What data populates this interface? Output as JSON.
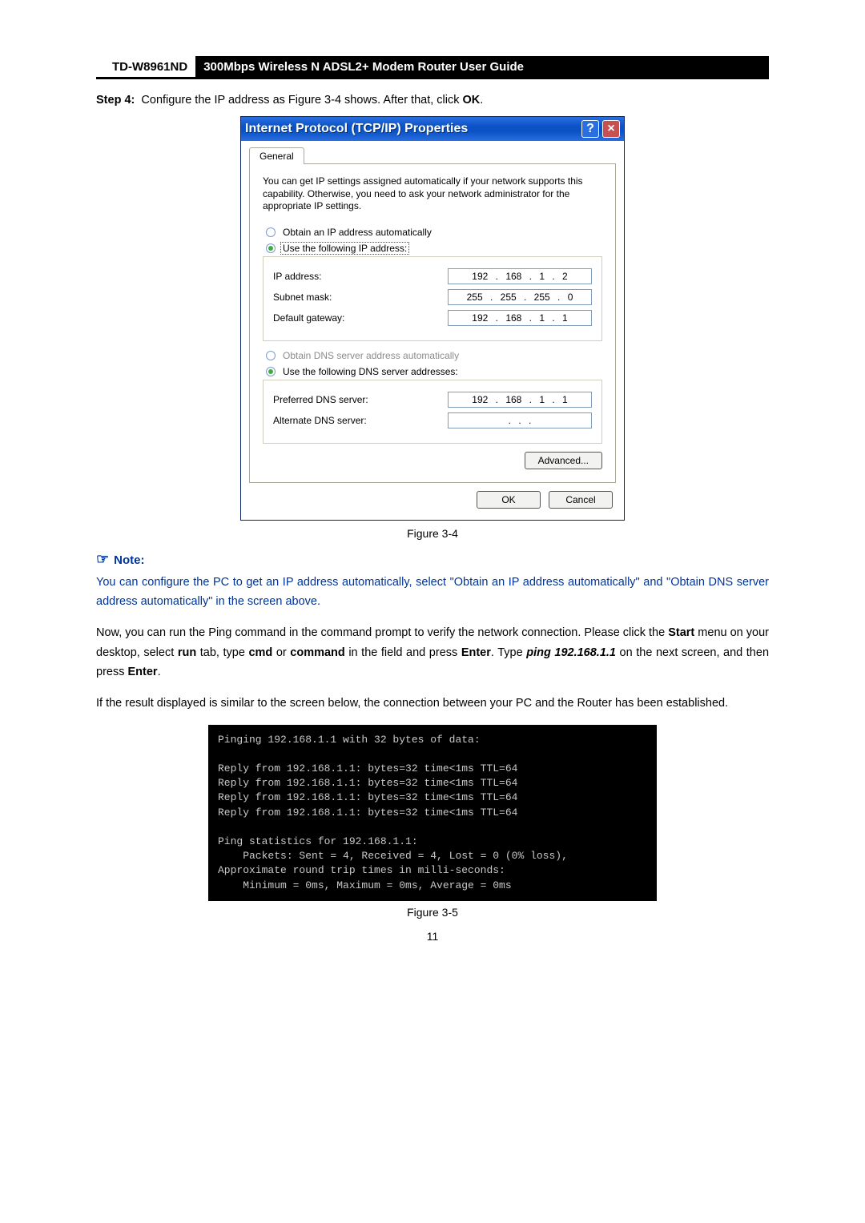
{
  "header": {
    "model": "TD-W8961ND",
    "title": "300Mbps Wireless N ADSL2+ Modem Router User Guide"
  },
  "step": {
    "label": "Step 4:",
    "text_before": "Configure the IP address as ",
    "fig_ref": "Figure 3-4",
    "text_mid": " shows. After that, click ",
    "ok": "OK",
    "tail": "."
  },
  "dialog": {
    "title": "Internet Protocol (TCP/IP) Properties",
    "help": "?",
    "close": "×",
    "tab": "General",
    "desc": "You can get IP settings assigned automatically if your network supports this capability. Otherwise, you need to ask your network administrator for the appropriate IP settings.",
    "r1": "Obtain an IP address automatically",
    "r2": "Use the following IP address:",
    "ip_label": "IP address:",
    "ip_val": "192 . 168 .  1  .  2",
    "subnet_label": "Subnet mask:",
    "subnet_val": "255 . 255 . 255 .  0",
    "gw_label": "Default gateway:",
    "gw_val": "192 . 168 .  1  .  1",
    "r3": "Obtain DNS server address automatically",
    "r4": "Use the following DNS server addresses:",
    "pdns_label": "Preferred DNS server:",
    "pdns_val": "192 . 168 .  1  .  1",
    "adns_label": "Alternate DNS server:",
    "adns_val": " .      .      . ",
    "advanced": "Advanced...",
    "ok": "OK",
    "cancel": "Cancel"
  },
  "fig1": "Figure 3-4",
  "note": {
    "icon": "☞",
    "label": "Note:",
    "body": "You can configure the PC to get an IP address automatically, select \"Obtain an IP address automatically\" and \"Obtain DNS server address automatically\" in the screen above."
  },
  "p1": {
    "a": "Now, you can run the Ping command in the command prompt to verify the network connection. Please click the ",
    "b1": "Start",
    "b": " menu on your desktop, select ",
    "b2": "run",
    "c": " tab, type ",
    "b3": "cmd",
    "d": " or ",
    "b4": "command",
    "e": " in the field and press ",
    "b5": "Enter",
    "f": ". Type ",
    "bi": "ping 192.168.1.1",
    "g": " on the next screen, and then press ",
    "b6": "Enter",
    "h": "."
  },
  "p2": "If the result displayed is similar to the screen below, the connection between your PC and the Router has been established.",
  "cmd": "Pinging 192.168.1.1 with 32 bytes of data:\n\nReply from 192.168.1.1: bytes=32 time<1ms TTL=64\nReply from 192.168.1.1: bytes=32 time<1ms TTL=64\nReply from 192.168.1.1: bytes=32 time<1ms TTL=64\nReply from 192.168.1.1: bytes=32 time<1ms TTL=64\n\nPing statistics for 192.168.1.1:\n    Packets: Sent = 4, Received = 4, Lost = 0 (0% loss),\nApproximate round trip times in milli-seconds:\n    Minimum = 0ms, Maximum = 0ms, Average = 0ms",
  "fig2": "Figure 3-5",
  "page_num": "11"
}
